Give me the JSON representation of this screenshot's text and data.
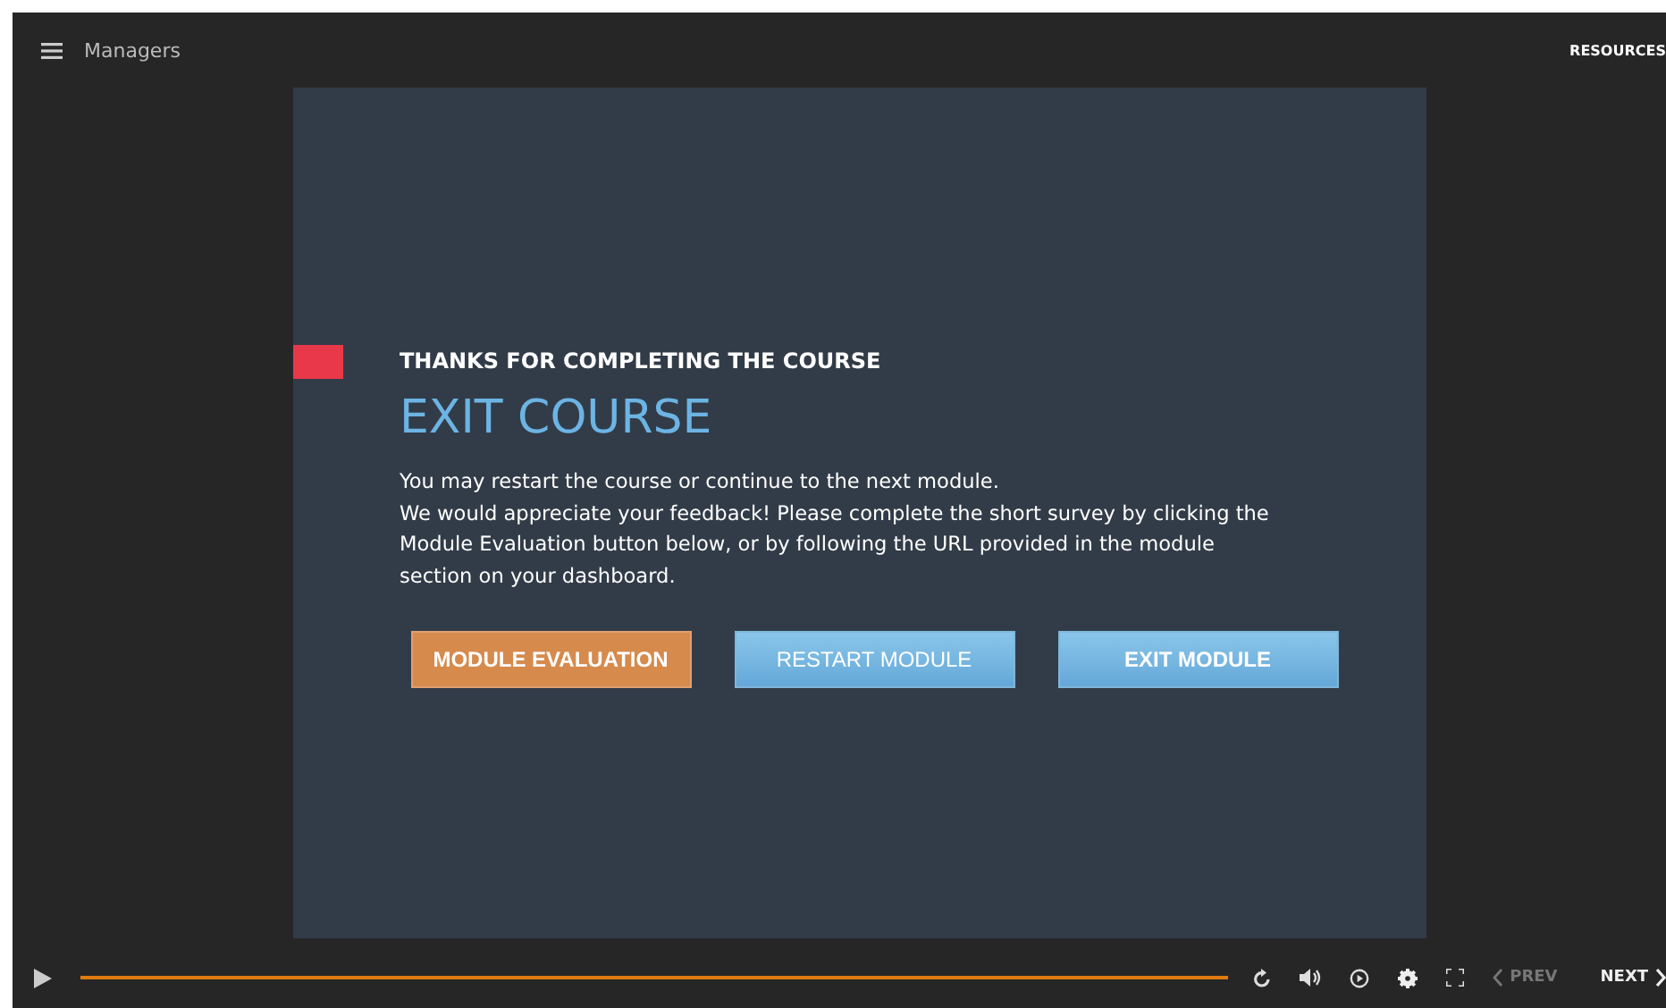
{
  "top_bar": {
    "title": "Managers",
    "resources": "RESOURCES"
  },
  "slide": {
    "heading": "THANKS FOR COMPLETING THE COURSE",
    "title": "EXIT COURSE",
    "paragraphs": [
      "You may restart the course or continue to the next module.",
      "We would appreciate your feedback! Please complete the short survey by clicking the Module Evaluation button below, or by following the URL provided in the module section on your dashboard."
    ],
    "buttons": [
      {
        "label": "MODULE EVALUATION",
        "kind": "accent",
        "bold": true
      },
      {
        "label": "RESTART MODULE",
        "kind": "primary",
        "bold": false
      },
      {
        "label": "EXIT MODULE",
        "kind": "primary",
        "bold": true
      }
    ]
  },
  "player": {
    "progress": {
      "level": 1
    },
    "prev": {
      "label": "PREV",
      "disabled": true
    },
    "next": {
      "label": "NEXT",
      "disabled": false
    }
  }
}
